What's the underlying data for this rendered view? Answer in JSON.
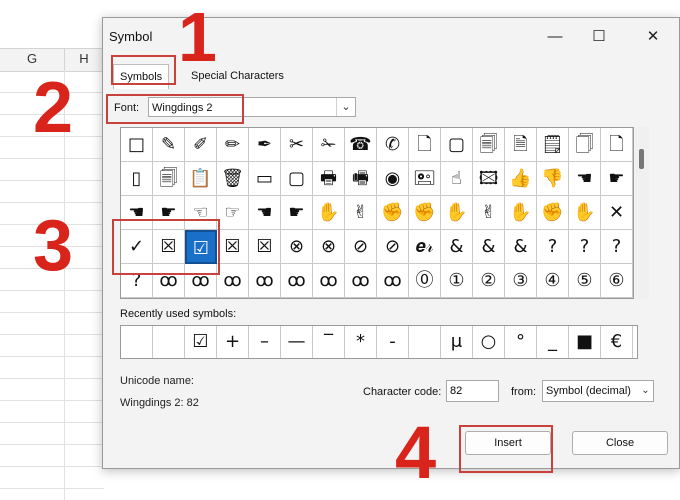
{
  "sheet": {
    "col_g": "G",
    "col_h": "H"
  },
  "dialog": {
    "title": "Symbol",
    "minimize": "—",
    "maximize": "☐",
    "close": "✕",
    "tabs": [
      {
        "label": "Symbols",
        "active": true
      },
      {
        "label": "Special Characters",
        "active": false
      }
    ],
    "font_label": "Font:",
    "font_value": "Wingdings 2",
    "symbol_rows": [
      [
        "□",
        "✎",
        "✐",
        "✏",
        "✒",
        "✂",
        "✁",
        "☎",
        "✆",
        "🗋",
        "▢",
        "🗐",
        "🗎",
        "🗒",
        "🗍",
        "🗋"
      ],
      [
        "▯",
        "🗐",
        "📋",
        "🗑",
        "▭",
        "▢",
        "🖶",
        "🖷",
        "◉",
        "🖭",
        "☝",
        "🖾",
        "👍",
        "👎",
        "☚",
        "☛"
      ],
      [
        "☚",
        "☛",
        "☜",
        "☞",
        "☚",
        "☛",
        "✋",
        "✌",
        "✊",
        "✊",
        "✋",
        "✌",
        "✋",
        "✊",
        "✋",
        "✕"
      ],
      [
        "✓",
        "☒",
        "☑",
        "☒",
        "☒",
        "⊗",
        "⊗",
        "⊘",
        "⊘",
        "𝒆𝓇",
        "&",
        "&",
        "&",
        "?",
        "?",
        "?"
      ],
      [
        "?",
        "ꝏ",
        "ꝏ",
        "ꝏ",
        "ꝏ",
        "ꝏ",
        "ꝏ",
        "ꝏ",
        "ꝏ",
        "⓪",
        "①",
        "②",
        "③",
        "④",
        "⑤",
        "⑥"
      ]
    ],
    "selected_cell": {
      "row": 3,
      "col": 2
    },
    "recent_label": "Recently used symbols:",
    "recent_symbols": [
      "",
      "",
      "☑",
      "+",
      "–",
      "—",
      "‾",
      "*",
      "-",
      "",
      "μ",
      "○",
      "°",
      "_",
      "■",
      "€"
    ],
    "unicode_name_label": "Unicode name:",
    "unicode_name_value": "Wingdings 2: 82",
    "char_code_label": "Character code:",
    "char_code_value": "82",
    "from_label": "from:",
    "from_value": "Symbol (decimal)",
    "insert_label": "Insert",
    "close_label": "Close"
  },
  "annotations": [
    "1",
    "2",
    "3",
    "4"
  ],
  "colors": {
    "annotation": "#d8241b",
    "selection": "#1a6fc9"
  }
}
